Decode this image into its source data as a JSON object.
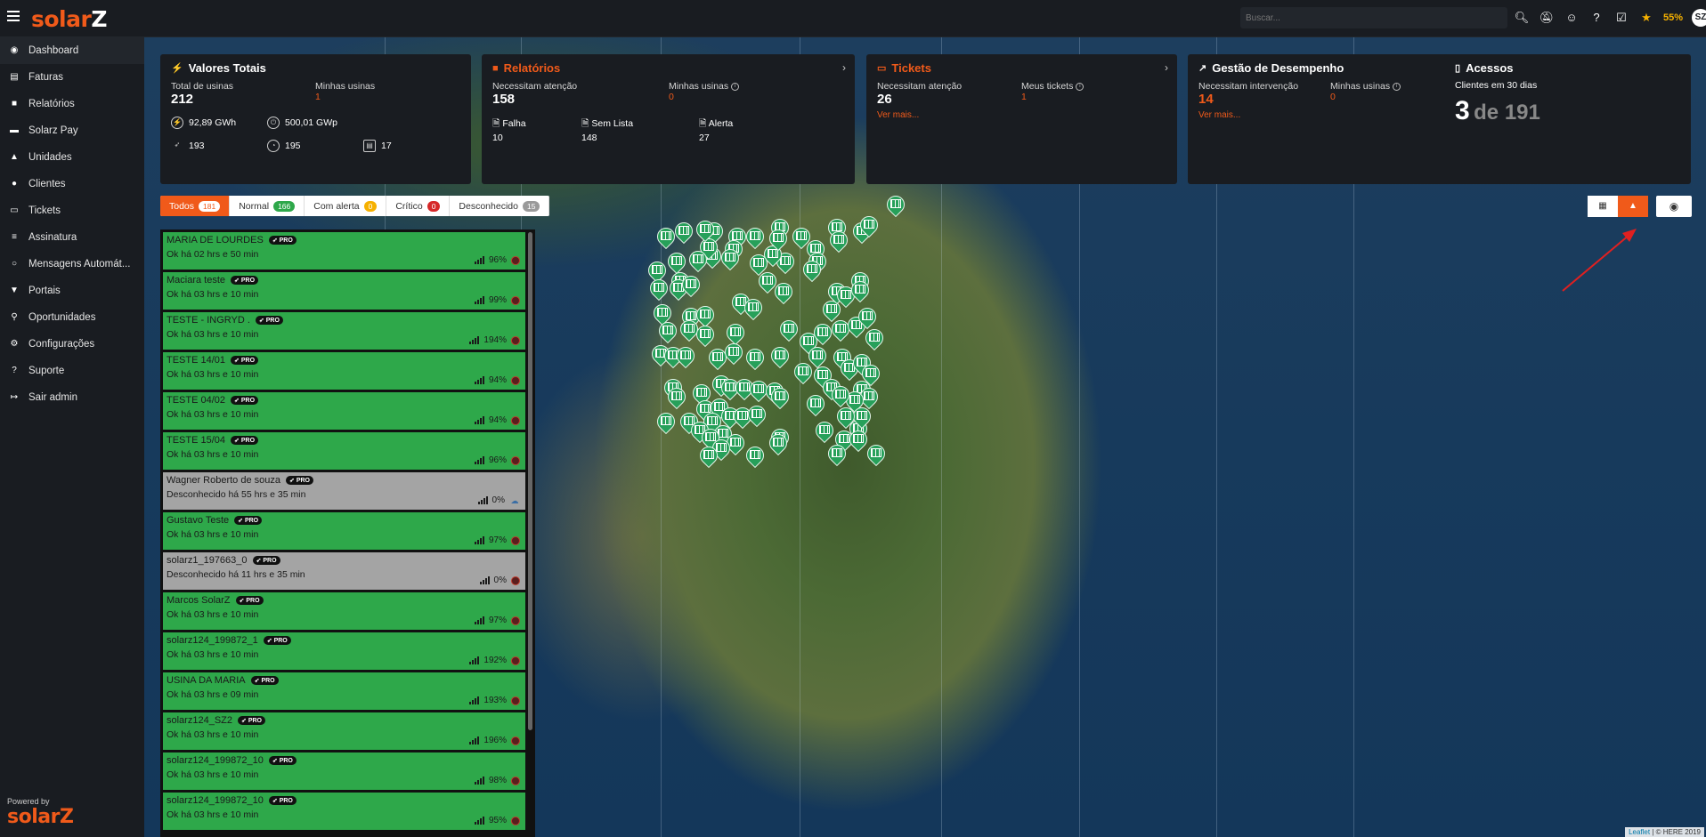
{
  "topbar": {
    "logo_main": "solar",
    "logo_z": "Z",
    "search_placeholder": "Buscar...",
    "icons": [
      "search-icon",
      "bell-off-icon",
      "user-icon",
      "help-icon",
      "clipboard-icon",
      "medal-icon"
    ],
    "progress_label": "55%",
    "avatar_text": "SZ"
  },
  "sidebar": {
    "items": [
      {
        "label": "Dashboard",
        "icon": "dashboard-icon"
      },
      {
        "label": "Faturas",
        "icon": "invoice-icon"
      },
      {
        "label": "Relatórios",
        "icon": "report-icon"
      },
      {
        "label": "Solarz Pay",
        "icon": "pay-icon"
      },
      {
        "label": "Unidades",
        "icon": "units-icon"
      },
      {
        "label": "Clientes",
        "icon": "clients-icon"
      },
      {
        "label": "Tickets",
        "icon": "ticket-icon"
      },
      {
        "label": "Assinatura",
        "icon": "subscription-icon"
      },
      {
        "label": "Mensagens Automát...",
        "icon": "whatsapp-icon"
      },
      {
        "label": "Portais",
        "icon": "portal-icon"
      },
      {
        "label": "Oportunidades",
        "icon": "search-icon"
      },
      {
        "label": "Configurações",
        "icon": "gear-icon"
      },
      {
        "label": "Suporte",
        "icon": "help-icon"
      },
      {
        "label": "Sair admin",
        "icon": "logout-icon"
      }
    ],
    "powered_by": "Powered by",
    "powered_logo": "solarZ"
  },
  "cards": {
    "valores": {
      "title": "Valores Totais",
      "total_label": "Total de usinas",
      "total_value": "212",
      "minhas_label": "Minhas usinas",
      "minhas_value": "1",
      "energy": "92,89 GWh",
      "power": "500,01 GWp",
      "stat_a": "193",
      "stat_b": "195",
      "stat_c": "17"
    },
    "relatorios": {
      "title": "Relatórios",
      "atencao_label": "Necessitam atenção",
      "atencao_value": "158",
      "minhas_label": "Minhas usinas",
      "minhas_value": "0",
      "falha_label": "Falha",
      "falha_value": "10",
      "semlista_label": "Sem Lista",
      "semlista_value": "148",
      "alerta_label": "Alerta",
      "alerta_value": "27"
    },
    "tickets": {
      "title": "Tickets",
      "atencao_label": "Necessitam atenção",
      "atencao_value": "26",
      "meus_label": "Meus tickets",
      "meus_value": "1",
      "ver_mais": "Ver mais..."
    },
    "gestao": {
      "title": "Gestão de Desempenho",
      "intervencao_label": "Necessitam intervenção",
      "intervencao_value": "14",
      "minhas_label": "Minhas usinas",
      "minhas_value": "0",
      "ver_mais": "Ver mais..."
    },
    "acessos": {
      "title": "Acessos",
      "sub": "Clientes em 30 dias",
      "value": "3",
      "of": "de 191"
    }
  },
  "filters": [
    {
      "label": "Todos",
      "count": "181",
      "color": "#f05a1a"
    },
    {
      "label": "Normal",
      "count": "166",
      "color": "#2ea84a"
    },
    {
      "label": "Com alerta",
      "count": "0",
      "color": "#f6b100"
    },
    {
      "label": "Crítico",
      "count": "0",
      "color": "#d62828"
    },
    {
      "label": "Desconhecido",
      "count": "15",
      "color": "#9a9a9a"
    }
  ],
  "plants": [
    {
      "name": "MARIA DE LOURDES",
      "status": "Ok há 02 hrs e 50 min",
      "pct": "96%",
      "state": "ok"
    },
    {
      "name": "Maciara teste",
      "status": "Ok há 03 hrs e 10 min",
      "pct": "99%",
      "state": "ok"
    },
    {
      "name": "TESTE - INGRYD .",
      "status": "Ok há 03 hrs e 10 min",
      "pct": "194%",
      "state": "ok"
    },
    {
      "name": "TESTE 14/01",
      "status": "Ok há 03 hrs e 10 min",
      "pct": "94%",
      "state": "ok"
    },
    {
      "name": "TESTE 04/02",
      "status": "Ok há 03 hrs e 10 min",
      "pct": "94%",
      "state": "ok"
    },
    {
      "name": "TESTE 15/04",
      "status": "Ok há 03 hrs e 10 min",
      "pct": "96%",
      "state": "ok"
    },
    {
      "name": "Wagner Roberto de souza",
      "status": "Desconhecido há 55 hrs e 35 min",
      "pct": "0%",
      "state": "gray"
    },
    {
      "name": "Gustavo Teste",
      "status": "Ok há 03 hrs e 10 min",
      "pct": "97%",
      "state": "ok"
    },
    {
      "name": "solarz1_197663_0",
      "status": "Desconhecido há 11 hrs e 35 min",
      "pct": "0%",
      "state": "gray"
    },
    {
      "name": "Marcos SolarZ",
      "status": "Ok há 03 hrs e 10 min",
      "pct": "97%",
      "state": "ok"
    },
    {
      "name": "solarz124_199872_1",
      "status": "Ok há 03 hrs e 10 min",
      "pct": "192%",
      "state": "ok"
    },
    {
      "name": "USINA DA MARIA",
      "status": "Ok há 03 hrs e 09 min",
      "pct": "193%",
      "state": "ok"
    },
    {
      "name": "solarz124_SZ2",
      "status": "Ok há 03 hrs e 10 min",
      "pct": "196%",
      "state": "ok"
    },
    {
      "name": "solarz124_199872_10",
      "status": "Ok há 03 hrs e 10 min",
      "pct": "98%",
      "state": "ok"
    },
    {
      "name": "solarz124_199872_10",
      "status": "Ok há 03 hrs e 10 min",
      "pct": "95%",
      "state": "ok"
    }
  ],
  "pro_label": "PRO",
  "map": {
    "attribution_leaflet": "Leaflet",
    "attribution_rest": "| © HERE 2019"
  }
}
